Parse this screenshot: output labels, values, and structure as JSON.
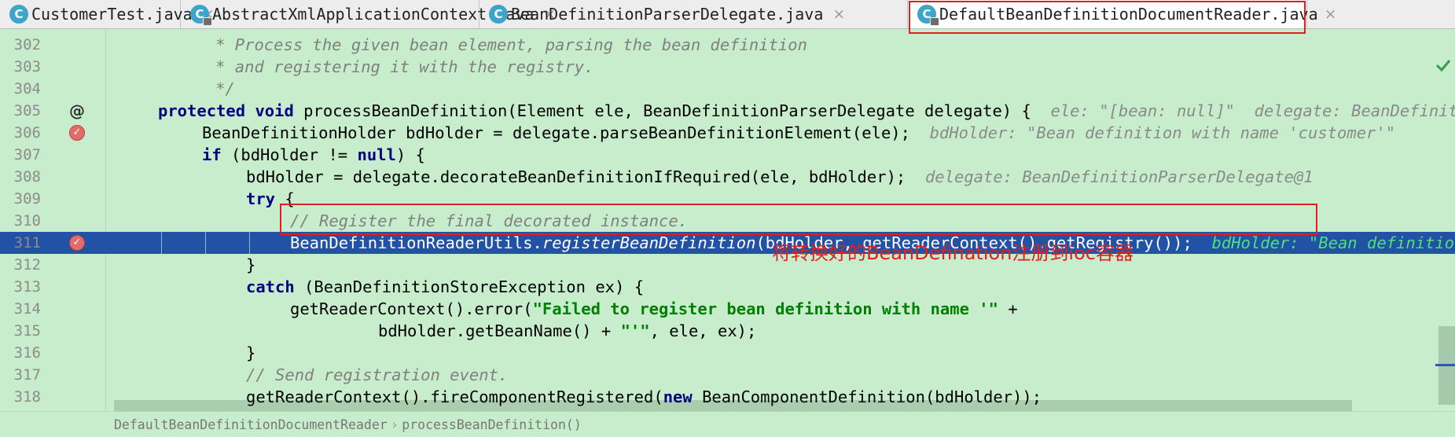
{
  "tabs": [
    {
      "label": "CustomerTest.java",
      "icon": "class-icon",
      "icon_letter": "C",
      "locked": false,
      "active": false
    },
    {
      "label": "AbstractXmlApplicationContext.java",
      "icon": "class-icon",
      "icon_letter": "C",
      "locked": true,
      "active": false
    },
    {
      "label": "BeanDefinitionParserDelegate.java",
      "icon": "class-icon",
      "icon_letter": "C",
      "locked": false,
      "active": false
    },
    {
      "label": "DefaultBeanDefinitionDocumentReader.java",
      "icon": "class-icon",
      "icon_letter": "C",
      "locked": true,
      "active": true
    }
  ],
  "tab_close_glyph": "×",
  "code_lines": [
    {
      "num": "302",
      "gutter": "",
      "text": "         * Process the given bean element, parsing the bean definition"
    },
    {
      "num": "303",
      "gutter": "",
      "text": "         * and registering it with the registry."
    },
    {
      "num": "304",
      "gutter": "",
      "text": "         */"
    },
    {
      "num": "305",
      "gutter": "@",
      "kw1": "protected",
      "kw2": "void",
      "text": " processBeanDefinition(Element ele, BeanDefinitionParserDelegate delegate) {  ",
      "hint": "ele: \"[bean: null]\"  delegate: BeanDefinitionParserDelegate@"
    },
    {
      "num": "306",
      "gutter": "breakpoint",
      "text": "BeanDefinitionHolder bdHolder = delegate.parseBeanDefinitionElement(ele);  ",
      "hint": "bdHolder: \"Bean definition with name 'customer'\""
    },
    {
      "num": "307",
      "gutter": "",
      "kw1": "if",
      "pre": " (bdHolder != ",
      "kw2": "null",
      "post": ") {"
    },
    {
      "num": "308",
      "gutter": "",
      "text": "bdHolder = delegate.decorateBeanDefinitionIfRequired(ele, bdHolder);  ",
      "hint": "delegate: BeanDefinitionParserDelegate@1"
    },
    {
      "num": "309",
      "gutter": "",
      "kw1": "try",
      "text": " {"
    },
    {
      "num": "310",
      "gutter": "",
      "text": "// Register the final decorated instance."
    },
    {
      "num": "311",
      "gutter": "breakpoint",
      "pre": "BeanDefinitionReaderUtils.",
      "ital": "registerBeanDefinition",
      "post": "(bdHolder, getReaderContext().getRegistry());  ",
      "hint": "bdHolder: \"Bean definition"
    },
    {
      "num": "312",
      "gutter": "",
      "text": "}"
    },
    {
      "num": "313",
      "gutter": "",
      "kw1": "catch",
      "text": " (BeanDefinitionStoreException ex) {"
    },
    {
      "num": "314",
      "gutter": "",
      "pre": "getReaderContext().error(",
      "str": "\"Failed to register bean definition with name '\"",
      "post": " +"
    },
    {
      "num": "315",
      "gutter": "",
      "pre": "bdHolder.getBeanName() + ",
      "str": "\"'\"",
      "post": ", ele, ex);"
    },
    {
      "num": "316",
      "gutter": "",
      "text": "}"
    },
    {
      "num": "317",
      "gutter": "",
      "text": "// Send registration event."
    },
    {
      "num": "318",
      "gutter": "",
      "pre": "getReaderContext().fireComponentRegistered(",
      "kw1": "new",
      "post": " BeanComponentDefinition(bdHolder));"
    }
  ],
  "current_line": "311",
  "annotation": "将转换好的BeanDefination注册到ioc容器",
  "breadcrumb": {
    "items": [
      "DefaultBeanDefinitionDocumentReader",
      "processBeanDefinition()"
    ],
    "separator": "›"
  },
  "colors": {
    "editor_bg": "#C7EDCC",
    "current_line_bg": "#2152A5",
    "keyword": "#000080",
    "string": "#008000",
    "comment": "#808080",
    "highlight_box": "#E01E1E",
    "annotation_text": "#E0201C",
    "tab_icon": "#3FA4C9",
    "breakpoint": "#E06C6C"
  }
}
